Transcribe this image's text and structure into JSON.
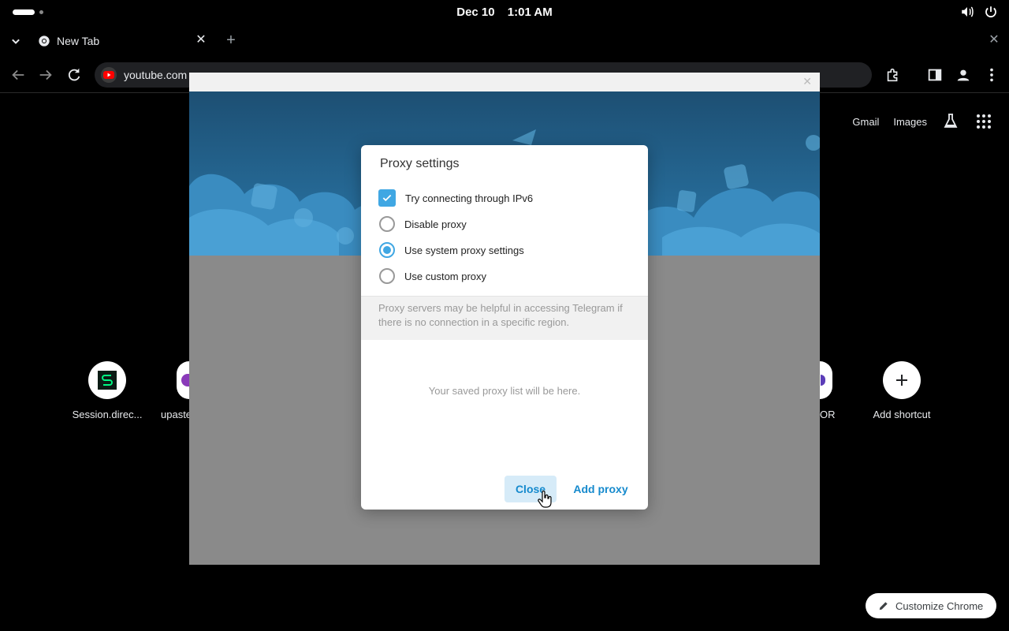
{
  "system": {
    "date": "Dec 10",
    "time": "1:01 AM"
  },
  "browser": {
    "tab_title": "New Tab",
    "url": "youtube.com"
  },
  "ntp": {
    "links": [
      "Gmail",
      "Images"
    ],
    "shortcuts": [
      {
        "label": "Session.direc..."
      },
      {
        "label": "upaste"
      },
      {
        "label": "OR"
      },
      {
        "label": "Add shortcut"
      }
    ],
    "customize_label": "Customize Chrome"
  },
  "dialog": {
    "title": "Proxy settings",
    "options": [
      {
        "label": "Try connecting through IPv6",
        "kind": "checkbox",
        "checked": true
      },
      {
        "label": "Disable proxy",
        "kind": "radio",
        "checked": false
      },
      {
        "label": "Use system proxy settings",
        "kind": "radio",
        "checked": true
      },
      {
        "label": "Use custom proxy",
        "kind": "radio",
        "checked": false
      }
    ],
    "about": "Proxy servers may be helpful in accessing Telegram if there is no connection in a specific region.",
    "empty_text": "Your saved proxy list will be here.",
    "close_label": "Close",
    "add_label": "Add proxy"
  },
  "colors": {
    "accent": "#40a7e3",
    "link": "#168acd",
    "header_blue": "#1d4f73"
  }
}
